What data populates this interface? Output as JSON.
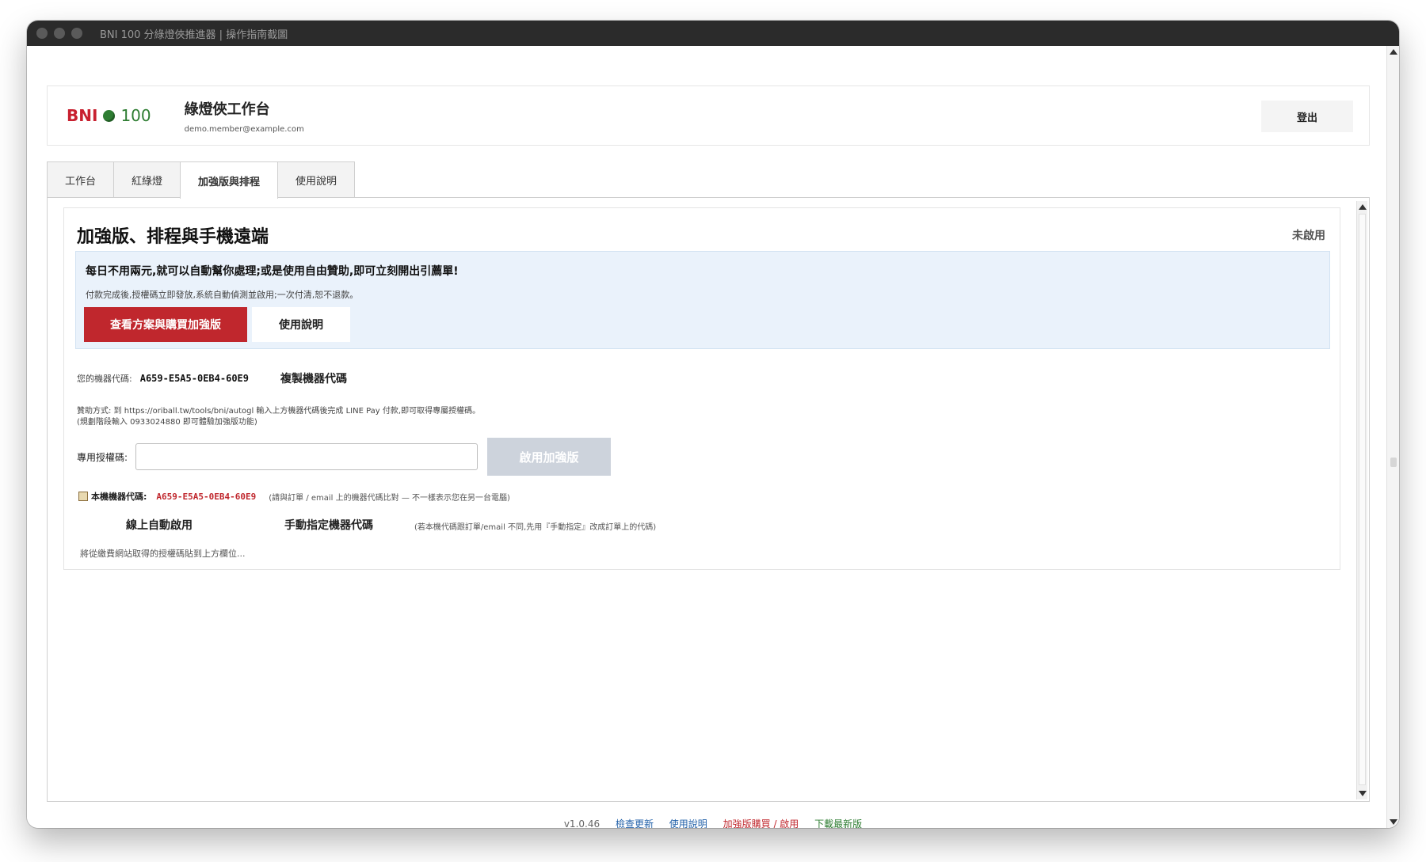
{
  "window": {
    "title": "BNI 100 分綠燈俠推進器 | 操作指南截圖"
  },
  "header": {
    "logo_bni": "BNI",
    "logo_num": "100",
    "title": "綠燈俠工作台",
    "email": "demo.member@example.com",
    "logout_label": "登出"
  },
  "tabs": [
    {
      "label": "工作台",
      "active": false
    },
    {
      "label": "紅綠燈",
      "active": false
    },
    {
      "label": "加強版與排程",
      "active": true
    },
    {
      "label": "使用說明",
      "active": false
    }
  ],
  "card": {
    "title": "加強版、排程與手機遠端",
    "status": "未啟用",
    "promo": {
      "headline": "每日不用兩元,就可以自動幫你處理;或是使用自由贊助,即可立刻開出引薦單!",
      "note": "付款完成後,授權碼立即發放,系統自動偵測並啟用;一次付清,恕不退款。",
      "buy_label": "查看方案與購買加強版",
      "guide_label": "使用說明"
    },
    "machine_code_label": "您的機器代碼:",
    "machine_code": "A659-E5A5-0EB4-60E9",
    "copy_label": "複製機器代碼",
    "sponsor_line1": "贊助方式: 到 https://oriball.tw/tools/bni/autogl  輸入上方機器代碼後完成 LINE Pay 付款,即可取得專屬授權碼。",
    "sponsor_line2": "(規劃階段輸入 0933024880 即可體驗加強版功能)",
    "auth_label": "專用授權碼:",
    "auth_value": "",
    "auth_placeholder": "",
    "activate_label": "啟用加強版",
    "local_label": "本機機器代碼:",
    "local_code": "A659-E5A5-0EB4-60E9",
    "local_note": "(請與訂單 / email 上的機器代碼比對 — 不一樣表示您在另一台電腦)",
    "auto_label": "線上自動啟用",
    "manual_label": "手動指定機器代碼",
    "manual_note": "(若本機代碼跟訂單/email 不同,先用『手動指定』改成訂單上的代碼)",
    "paste_hint": "將從繳費網站取得的授權碼貼到上方欄位..."
  },
  "footer": {
    "version": "v1.0.46",
    "check_update": "檢查更新",
    "guide": "使用說明",
    "purchase": "加強版購買 / 啟用",
    "download": "下載最新版"
  },
  "colors": {
    "brand_red": "#c0272d",
    "brand_green": "#2e7d32",
    "promo_bg": "#eaf2fb",
    "disabled_btn": "#cdd3dc"
  }
}
